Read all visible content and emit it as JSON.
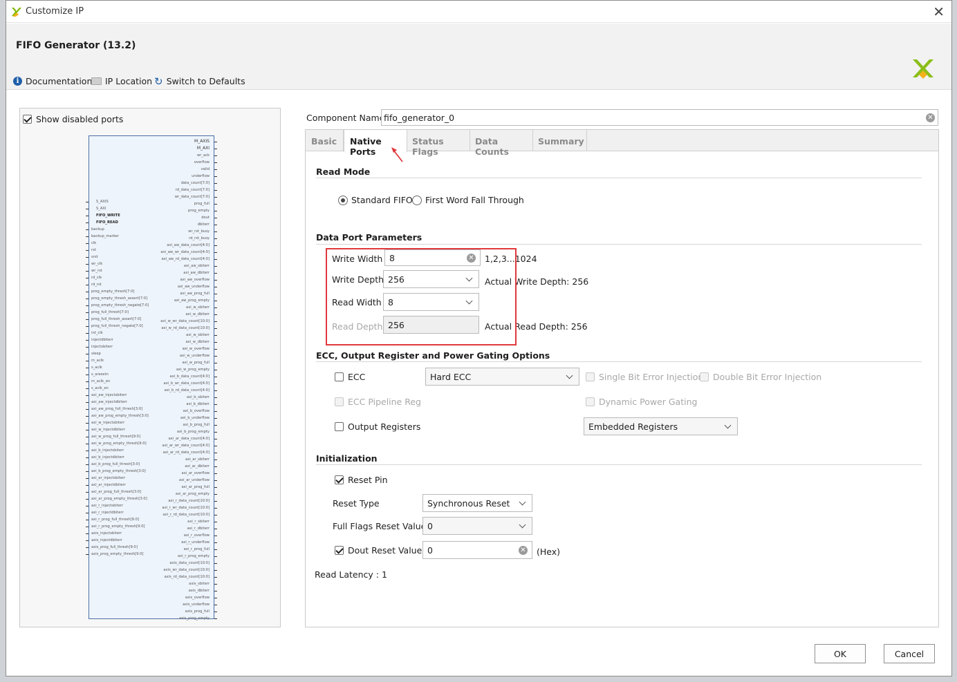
{
  "window": {
    "title": "Customize IP"
  },
  "header": {
    "ip_title": "FIFO Generator (13.2)",
    "toolbar": {
      "documentation": "Documentation",
      "ip_location": "IP Location",
      "switch_defaults": "Switch to Defaults"
    }
  },
  "left_panel": {
    "show_disabled_label": "Show disabled ports",
    "show_disabled_checked": true,
    "right_pins": [
      "M_AXIS",
      "M_AXI",
      "wr_ack",
      "overflow",
      "valid",
      "underflow",
      "data_count[7:0]",
      "rd_data_count[7:0]",
      "wr_data_count[7:0]",
      "prog_full",
      "prog_empty",
      "dout",
      "dbiterr",
      "wr_rst_busy",
      "rd_rst_busy",
      "axi_aw_data_count[4:0]",
      "axi_aw_wr_data_count[4:0]",
      "axi_aw_rd_data_count[4:0]",
      "axi_aw_sbiterr",
      "axi_aw_dbiterr",
      "axi_aw_overflow",
      "axi_aw_underflow",
      "axi_aw_prog_full",
      "axi_aw_prog_empty",
      "axi_w_sbiterr",
      "axi_w_dbiterr",
      "axi_w_wr_data_count[10:0]",
      "axi_w_rd_data_count[10:0]",
      "axi_w_sbiterr",
      "axi_w_dbiterr",
      "axi_w_overflow",
      "axi_w_underflow",
      "axi_w_prog_full",
      "axi_w_prog_empty",
      "axi_b_data_count[4:0]",
      "axi_b_wr_data_count[4:0]",
      "axi_b_rd_data_count[4:0]",
      "axi_b_sbiterr",
      "axi_b_dbiterr",
      "axi_b_overflow",
      "axi_b_underflow",
      "axi_b_prog_full",
      "axi_b_prog_empty",
      "axi_ar_data_count[4:0]",
      "axi_ar_wr_data_count[4:0]",
      "axi_ar_rd_data_count[4:0]",
      "axi_ar_sbiterr",
      "axi_ar_dbiterr",
      "axi_ar_overflow",
      "axi_ar_underflow",
      "axi_ar_prog_full",
      "axi_ar_prog_empty",
      "axi_r_data_count[10:0]",
      "axi_r_wr_data_count[10:0]",
      "axi_r_rd_data_count[10:0]",
      "axi_r_sbiterr",
      "axi_r_dbiterr",
      "axi_r_overflow",
      "axi_r_underflow",
      "axi_r_prog_full",
      "axi_r_prog_empty",
      "axis_data_count[10:0]",
      "axis_wr_data_count[10:0]",
      "axis_rd_data_count[10:0]",
      "axis_sbiterr",
      "axis_dbiterr",
      "axis_overflow",
      "axis_underflow",
      "axis_prog_full",
      "axis_prog_empty"
    ],
    "left_pins": [
      "S_AXIS",
      "S_AXI",
      "FIFO_WRITE",
      "FIFO_READ",
      "backup",
      "backup_marker",
      "clk",
      "rst",
      "srst",
      "wr_clk",
      "wr_rst",
      "rd_clk",
      "rd_rst",
      "prog_empty_thresh[7:0]",
      "prog_empty_thresh_assert[7:0]",
      "prog_empty_thresh_negate[7:0]",
      "prog_full_thresh[7:0]",
      "prog_full_thresh_assert[7:0]",
      "prog_full_thresh_negate[7:0]",
      "int_clk",
      "injectdbiterr",
      "injectsbiterr",
      "sleep",
      "m_aclk",
      "s_aclk",
      "s_aresetn",
      "m_aclk_en",
      "s_aclk_en",
      "axi_aw_injectsbiterr",
      "axi_aw_injectdbiterr",
      "axi_aw_prog_full_thresh[3:0]",
      "axi_aw_prog_empty_thresh[3:0]",
      "axi_w_injectsbiterr",
      "axi_w_injectdbiterr",
      "axi_w_prog_full_thresh[9:0]",
      "axi_w_prog_empty_thresh[9:0]",
      "axi_b_injectsbiterr",
      "axi_b_injectdbiterr",
      "axi_b_prog_full_thresh[3:0]",
      "axi_b_prog_empty_thresh[3:0]",
      "axi_ar_injectsbiterr",
      "axi_ar_injectdbiterr",
      "axi_ar_prog_full_thresh[3:0]",
      "axi_ar_prog_empty_thresh[3:0]",
      "axi_r_injectsbiterr",
      "axi_r_injectdbiterr",
      "axi_r_prog_full_thresh[9:0]",
      "axi_r_prog_empty_thresh[9:0]",
      "axis_injectsbiterr",
      "axis_injectdbiterr",
      "axis_prog_full_thresh[9:0]",
      "axis_prog_empty_thresh[9:0]"
    ]
  },
  "component": {
    "label": "Component Name",
    "value": "fifo_generator_0"
  },
  "tabs": [
    {
      "label": "Basic"
    },
    {
      "label": "Native Ports"
    },
    {
      "label": "Status Flags"
    },
    {
      "label": "Data Counts"
    },
    {
      "label": "Summary"
    }
  ],
  "read_mode": {
    "heading": "Read Mode",
    "standard": "Standard FIFO",
    "fwft": "First Word Fall Through"
  },
  "data_port": {
    "heading": "Data Port Parameters",
    "write_width_label": "Write Width",
    "write_width_value": "8",
    "write_width_range": "1,2,3...1024",
    "write_depth_label": "Write Depth",
    "write_depth_value": "256",
    "actual_write_depth": "Actual Write Depth: 256",
    "read_width_label": "Read Width",
    "read_width_value": "8",
    "read_depth_label": "Read Depth",
    "read_depth_value": "256",
    "actual_read_depth": "Actual Read Depth: 256"
  },
  "ecc": {
    "heading": "ECC, Output Register and Power Gating Options",
    "ecc_label": "ECC",
    "ecc_type": "Hard ECC",
    "single_bit": "Single Bit Error Injection",
    "double_bit": "Double Bit Error Injection",
    "pipeline": "ECC Pipeline Reg",
    "dynamic_power": "Dynamic Power Gating",
    "output_registers": "Output Registers",
    "register_type": "Embedded Registers"
  },
  "init": {
    "heading": "Initialization",
    "reset_pin": "Reset Pin",
    "reset_type_label": "Reset Type",
    "reset_type_value": "Synchronous Reset",
    "full_flags_label": "Full Flags Reset Value",
    "full_flags_value": "0",
    "dout_reset_label": "Dout Reset Value",
    "dout_reset_value": "0",
    "hex": "(Hex)",
    "read_latency": "Read Latency : 1"
  },
  "buttons": {
    "ok": "OK",
    "cancel": "Cancel"
  },
  "colors": {
    "accent": "#1f5fa8",
    "highlight": "#e0383b",
    "logo": "#7fb800"
  }
}
